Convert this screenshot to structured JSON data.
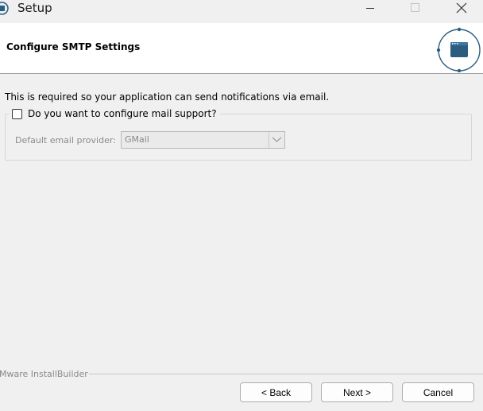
{
  "window": {
    "title": "Setup",
    "icon": "installer-app-icon"
  },
  "header": {
    "title": "Configure SMTP Settings",
    "logo": "window-badge-icon"
  },
  "content": {
    "description": "This is required so your application can send notifications via email.",
    "mail_support": {
      "label": "Do you want to configure mail support?",
      "checked": false
    },
    "provider": {
      "label": "Default email provider:",
      "value": "GMail",
      "enabled": false
    }
  },
  "footer": {
    "brand": "Mware InstallBuilder",
    "back_label": "< Back",
    "next_label": "Next >",
    "cancel_label": "Cancel"
  },
  "colors": {
    "background": "#f0f0f0",
    "header_background": "#ffffff",
    "logo_accent": "#2b5d80",
    "disabled_text": "#8a8a8a"
  }
}
